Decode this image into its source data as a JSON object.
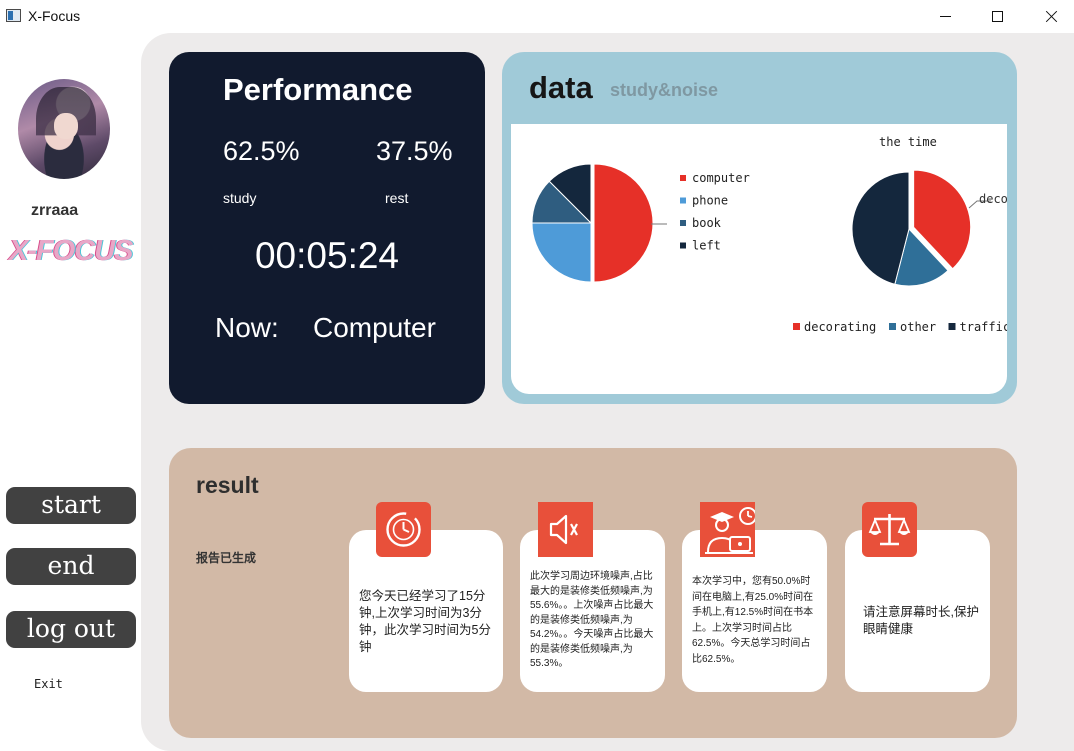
{
  "window": {
    "title": "X-Focus"
  },
  "sidebar": {
    "username": "zrraaa",
    "logo": "X-FOCUS",
    "buttons": {
      "start": "start",
      "end": "end",
      "logout": "log out"
    },
    "exit": "Exit"
  },
  "performance": {
    "title": "Performance",
    "study_percent": "62.5%",
    "rest_percent": "37.5%",
    "study_label": "study",
    "rest_label": "rest",
    "timer": "00:05:24",
    "now_label": "Now:",
    "current_activity": "Computer"
  },
  "data_panel": {
    "title": "data",
    "subtitle": "study&noise"
  },
  "chart_data": [
    {
      "type": "pie",
      "title": "",
      "categories": [
        "computer",
        "phone",
        "book",
        "left"
      ],
      "values": [
        50.0,
        25.0,
        12.5,
        12.5
      ],
      "colors": [
        "#e63028",
        "#4e9bd8",
        "#2f5d80",
        "#14273d"
      ],
      "legend_position": "right",
      "slice_label": ""
    },
    {
      "type": "pie",
      "title": "the time",
      "categories": [
        "decorating",
        "other",
        "traffic"
      ],
      "values": [
        38,
        16,
        46
      ],
      "colors": [
        "#e63028",
        "#2f6f98",
        "#14273d"
      ],
      "legend_position": "bottom",
      "slice_label": "deco"
    }
  ],
  "result": {
    "title": "result",
    "status": "报告已生成",
    "cards": [
      {
        "icon": "clock-icon",
        "text": "您今天已经学习了15分钟,上次学习时间为3分钟，此次学习时间为5分钟"
      },
      {
        "icon": "speaker-icon",
        "text": "此次学习周边环境噪声,占比最大的是装修类低频噪声,为55.6%。。上次噪声占比最大的是装修类低频噪声,为54.2%。。今天噪声占比最大的是装修类低频噪声,为55.3%。"
      },
      {
        "icon": "student-computer-icon",
        "text": "本次学习中，您有50.0%时间在电脑上,有25.0%时间在手机上,有12.5%时间在书本上。上次学习时间占比62.5%。今天总学习时间占比62.5%。"
      },
      {
        "icon": "scale-icon",
        "text": "请注意屏幕时长,保护眼睛健康"
      }
    ]
  },
  "colors": {
    "performance_bg": "#111a2e",
    "data_bg": "#a0cad8",
    "result_bg": "#d2b9a6",
    "icon_accent": "#e8503a",
    "button_bg": "#414141"
  }
}
